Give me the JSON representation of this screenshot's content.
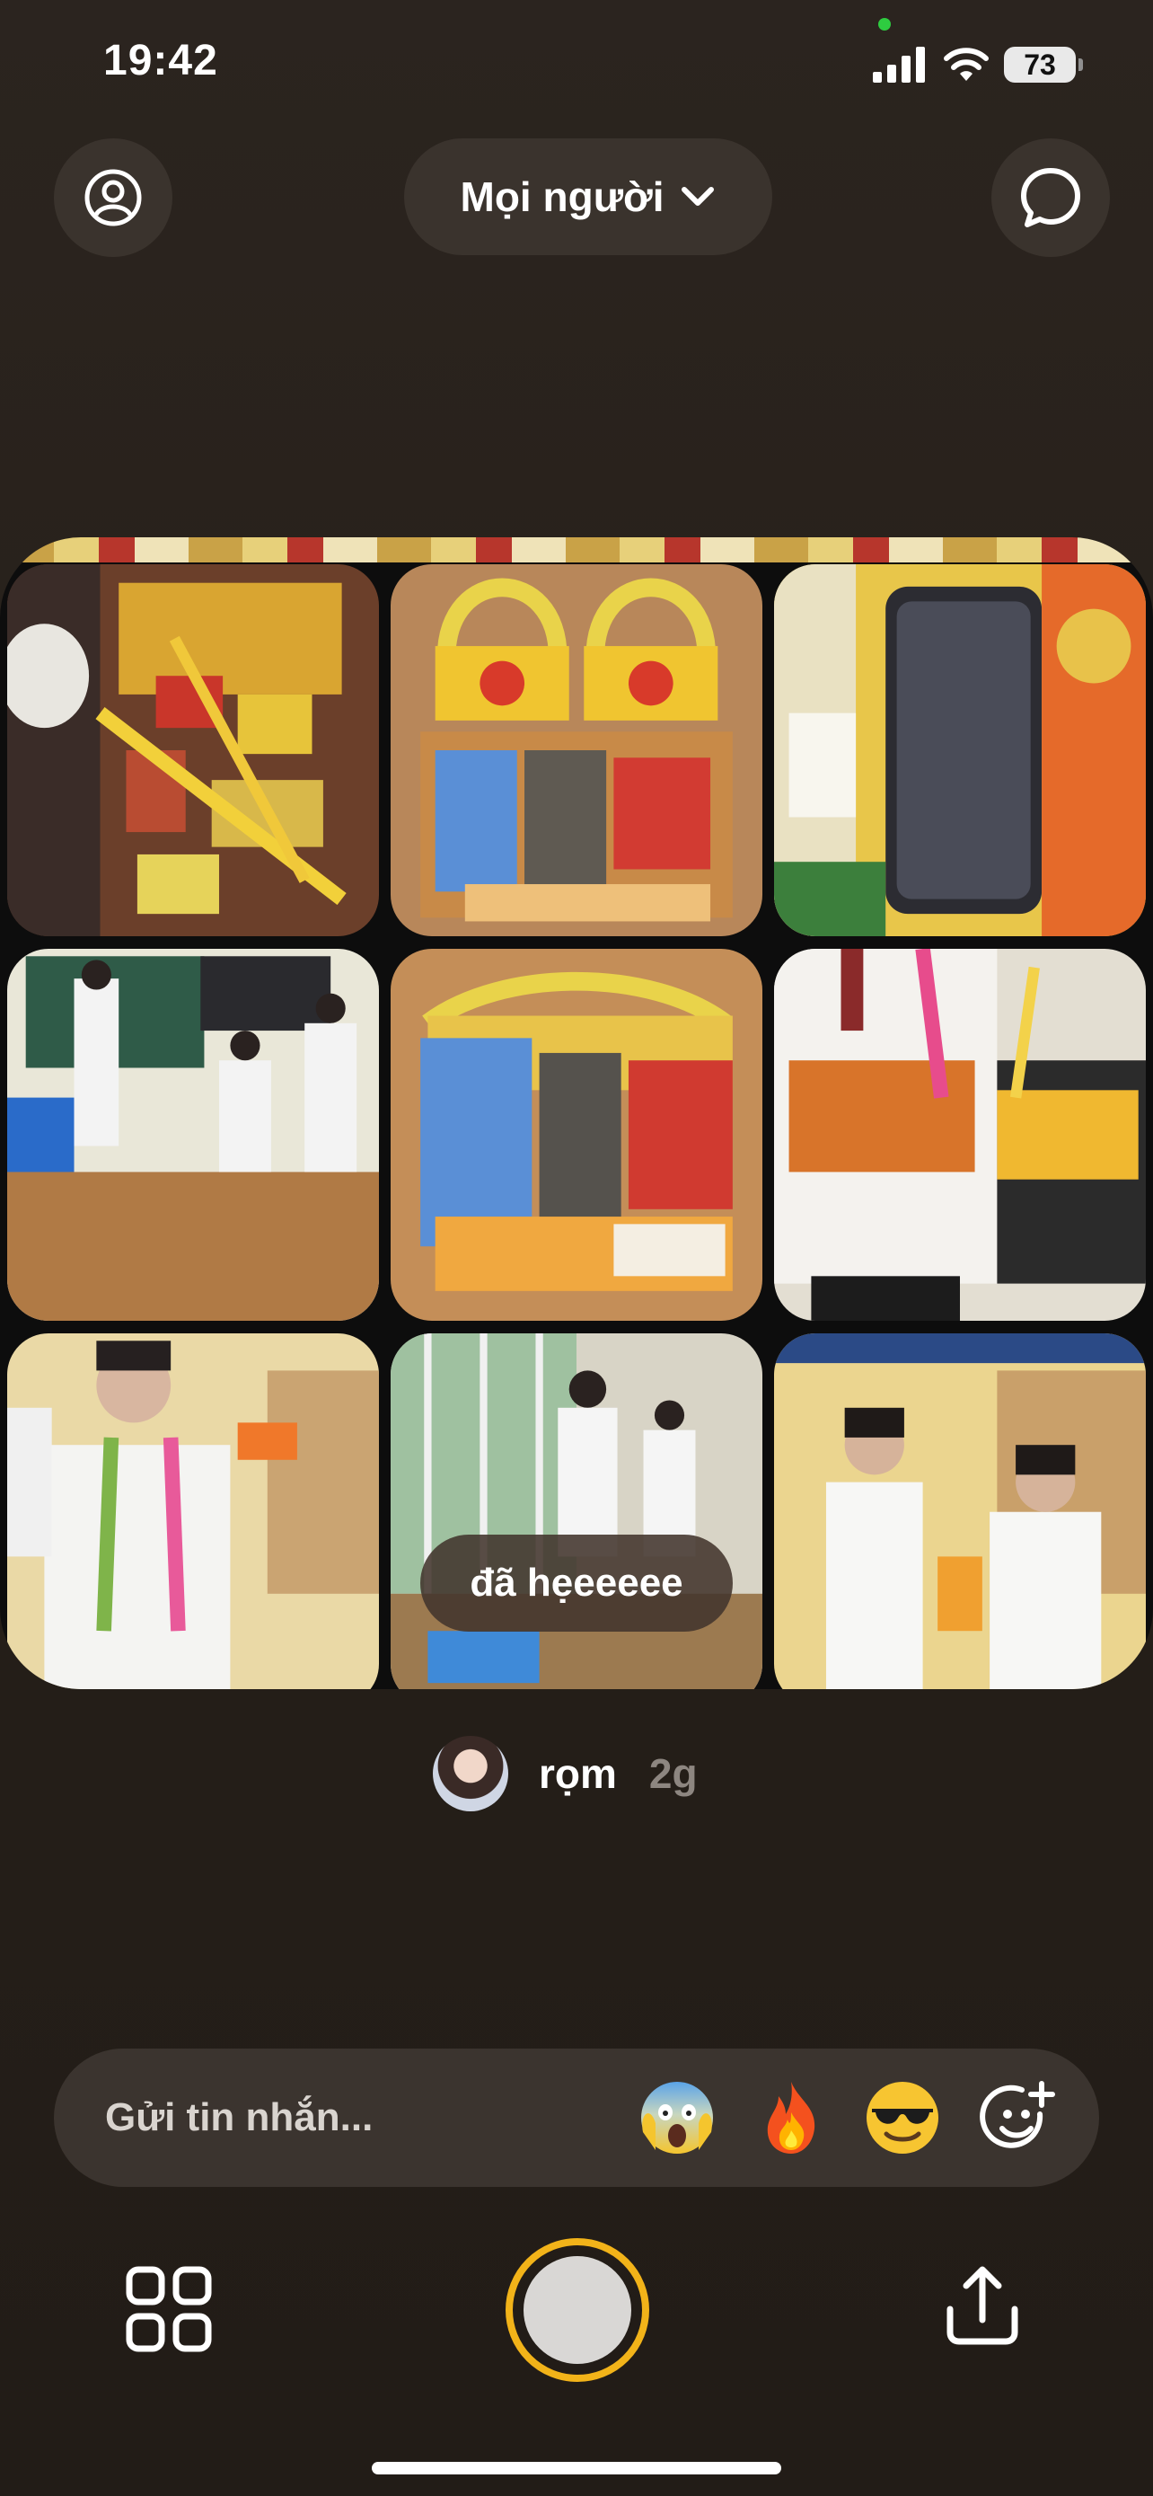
{
  "status_bar": {
    "time": "19:42",
    "battery": "73"
  },
  "header": {
    "audience_label": "Mọi người"
  },
  "post": {
    "caption": "đã hẹeeeee",
    "author_name": "rọm",
    "time_ago": "2g",
    "photos": [
      "candy-on-table",
      "candy-bag-chupa",
      "phone-with-candy",
      "classroom-students",
      "candy-bag-metacare",
      "student-wearing-candy",
      "student-smiling-lanyard",
      "classroom-window",
      "two-girls-posing"
    ]
  },
  "message_bar": {
    "placeholder": "Gửi tin nhắn...",
    "reactions": [
      "😱",
      "🔥",
      "😎"
    ]
  },
  "colors": {
    "shutter_ring": "#f2b319",
    "background": "#262019",
    "pill": "#3a332d"
  },
  "icons": {
    "profile": "profile-icon",
    "chat": "chat-bubble-icon",
    "chevron": "chevron-down-icon",
    "grid": "grid-icon",
    "share": "share-icon",
    "add_reaction": "add-reaction-icon"
  }
}
